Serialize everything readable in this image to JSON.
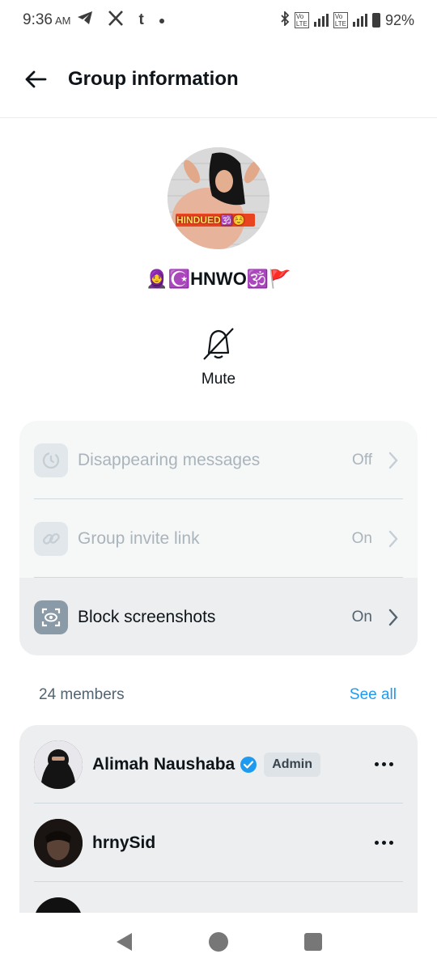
{
  "status_bar": {
    "time": "9:36",
    "ampm": "AM",
    "app_icons": [
      "telegram-icon",
      "x-icon",
      "tumblr-icon",
      "dot-icon"
    ],
    "tumblr_glyph": "t",
    "battery": "92%"
  },
  "header": {
    "title": "Group information"
  },
  "group": {
    "name": "🧕☪️HNWO🕉️🚩",
    "avatar_caption": "HINDUED🕉️☺️"
  },
  "mute": {
    "label": "Mute"
  },
  "settings": [
    {
      "label": "Disappearing messages",
      "value": "Off",
      "icon": "timer-icon",
      "state": "disabled"
    },
    {
      "label": "Group invite link",
      "value": "On",
      "icon": "link-icon",
      "state": "disabled"
    },
    {
      "label": "Block screenshots",
      "value": "On",
      "icon": "screenshot-block-icon",
      "state": "active"
    }
  ],
  "members": {
    "count_label": "24 members",
    "see_all_label": "See all",
    "list": [
      {
        "name": "Alimah Naushaba",
        "verified": true,
        "badge": "Admin"
      },
      {
        "name": "hrnySid",
        "verified": false,
        "badge": ""
      }
    ]
  },
  "colors": {
    "accent": "#1d9bf0",
    "text": "#0f1419",
    "muted": "#536471",
    "disabled": "#aab4bb"
  }
}
